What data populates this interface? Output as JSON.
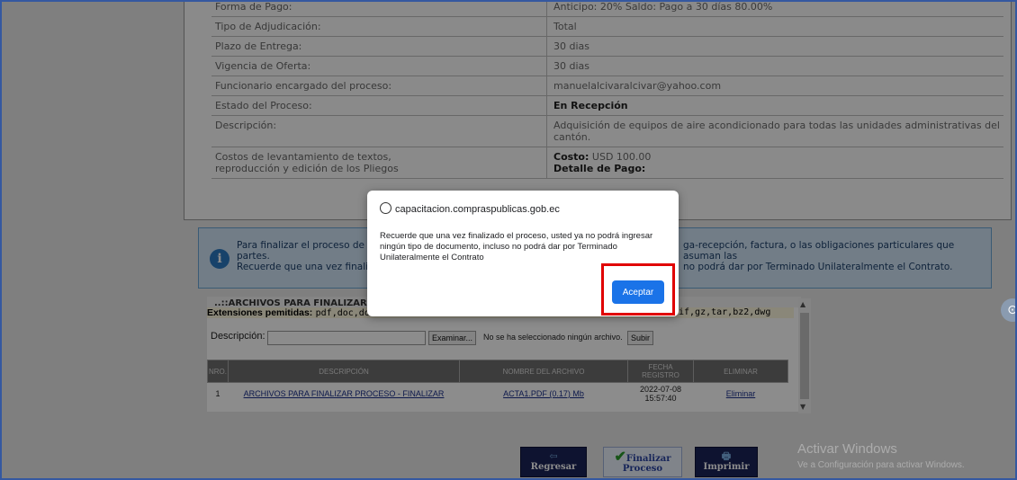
{
  "info_rows": [
    {
      "label": "Forma de Pago:",
      "value": "Anticipo: 20% Saldo: Pago a 30 días 80.00%"
    },
    {
      "label": "Tipo de Adjudicación:",
      "value": "Total"
    },
    {
      "label": "Plazo de Entrega:",
      "value": "30 dias"
    },
    {
      "label": "Vigencia de Oferta:",
      "value": "30 dias"
    },
    {
      "label": "Funcionario encargado del proceso:",
      "value": "manuelalcivaralcivar@yahoo.com"
    },
    {
      "label": "Estado del Proceso:",
      "value": "En Recepción"
    },
    {
      "label": "Descripción:",
      "value": "Adquisición de equipos de aire acondicionado para todas las unidades administrativas del cantón."
    }
  ],
  "costos": {
    "label": "Costos de levantamiento de textos, reproducción y edición de los Pliegos",
    "costo_label": "Costo:",
    "costo_value": "USD 100.00",
    "detalle_label": "Detalle de Pago:"
  },
  "info_box": {
    "line1_left": "Para finalizar el proceso de co",
    "line1_right": "ga-recepción, factura, o las obligaciones particulares que asuman las",
    "line2": "partes.",
    "line3_left": "Recuerde que una vez finalizado",
    "line3_right": "no podrá dar por Terminado Unilateralmente el Contrato."
  },
  "files": {
    "header": "..::ARCHIVOS PARA FINALIZAR PROCE",
    "ext_label": "Extensiones pemitidas:",
    "ext_left": "pdf,doc,doc",
    "ext_right": "if,gz,tar,bz2,dwg",
    "desc_label": "Descripción:",
    "browse_button": "Examinar...",
    "no_file": "No se ha seleccionado ningún archivo.",
    "upload_button": "Subir",
    "columns": [
      "NRO.",
      "DESCRIPCIÓN",
      "NOMBRE DEL ARCHIVO",
      "FECHA REGISTRO",
      "ELIMINAR"
    ],
    "rows": [
      {
        "nro": "1",
        "descripcion": "ARCHIVOS PARA FINALIZAR PROCESO - FINALIZAR",
        "archivo": "ACTA1.PDF (0.17) Mb",
        "fecha": "2022-07-08",
        "hora": "15:57:40",
        "eliminar": "Eliminar"
      }
    ]
  },
  "buttons": {
    "regresar": "Regresar",
    "finalizar_1": "Finalizar",
    "finalizar_2": "Proceso",
    "imprimir": "Imprimir"
  },
  "watermark": {
    "title": "Activar Windows",
    "subtitle": "Ve a Configuración para activar Windows."
  },
  "dialog": {
    "origin": "capacitacion.compraspublicas.gob.ec",
    "message": "Recuerde que una vez finalizado el proceso, usted ya no podrá ingresar ningún tipo de documento, incluso no podrá dar por Terminado Unilateralmente el Contrato",
    "ok_label": "Aceptar"
  }
}
